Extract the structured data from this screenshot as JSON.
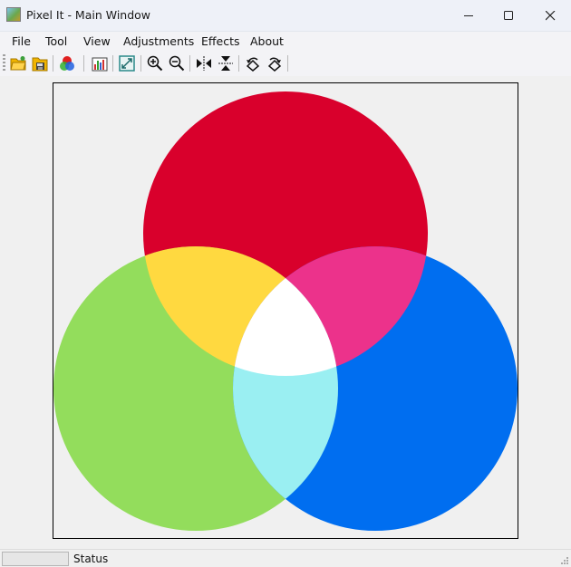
{
  "window": {
    "title": "Pixel It - Main Window",
    "controls": {
      "minimize_icon": "minimize-icon",
      "maximize_icon": "maximize-icon",
      "close_icon": "close-icon"
    }
  },
  "menu": [
    "File",
    "Tool",
    "View",
    "Adjustments",
    "Effects",
    "About"
  ],
  "toolbar": {
    "icons": [
      "open-folder-icon",
      "save-icon",
      "color-channels-icon",
      "histogram-icon",
      "resize-icon",
      "zoom-in-icon",
      "zoom-out-icon",
      "flip-horizontal-icon",
      "flip-vertical-icon",
      "rotate-left-icon",
      "rotate-right-icon"
    ]
  },
  "image": {
    "colors": {
      "red": "#d9002c",
      "green": "#93dd5c",
      "blue": "#006ef0",
      "yellow": "#ffd940",
      "magenta": "#ec328b",
      "cyan": "#9aeff2",
      "white": "#ffffff"
    }
  },
  "status": {
    "progress": 0,
    "text": "Status"
  }
}
